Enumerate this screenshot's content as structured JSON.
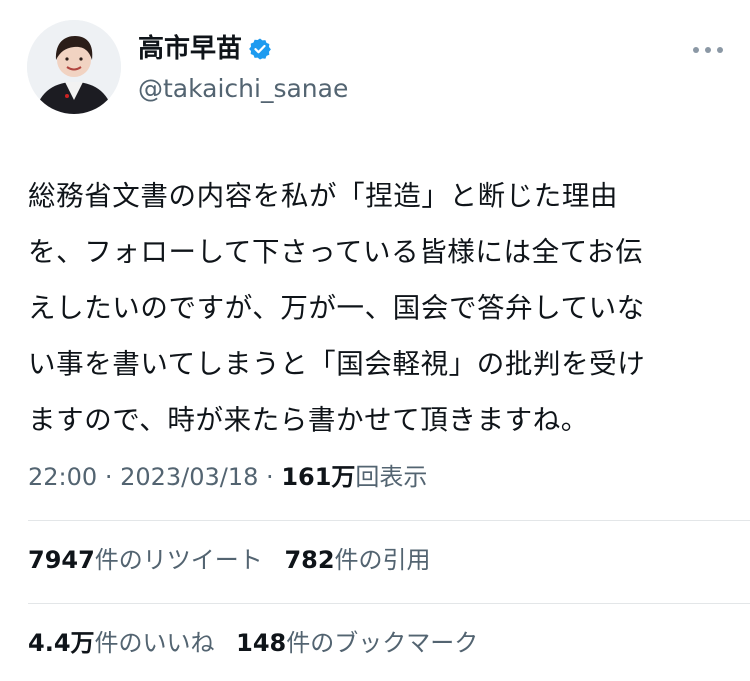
{
  "author": {
    "display_name": "高市早苗",
    "handle": "@takaichi_sanae",
    "verified_color": "#1d9bf0"
  },
  "tweet": {
    "lines": [
      "総務省文書の内容を私が「捏造」と断じた理由",
      "を、フォローして下さっている皆様には全てお伝",
      "えしたいのですが、万が一、国会で答弁していな",
      "い事を書いてしまうと「国会軽視」の批判を受け",
      "ますので、時が来たら書かせて頂きますね。"
    ]
  },
  "meta": {
    "time": "22:00",
    "date": "2023/03/18",
    "views_count": "161万",
    "views_label": "回表示"
  },
  "stats": {
    "retweets_count": "7947",
    "retweets_label": "件のリツイート",
    "quotes_count": "782",
    "quotes_label": "件の引用",
    "likes_count": "4.4万",
    "likes_label": "件のいいね",
    "bookmarks_count": "148",
    "bookmarks_label": "件のブックマーク"
  },
  "icons": [
    "avatar-image",
    "verified-badge-icon",
    "more-options-icon"
  ]
}
